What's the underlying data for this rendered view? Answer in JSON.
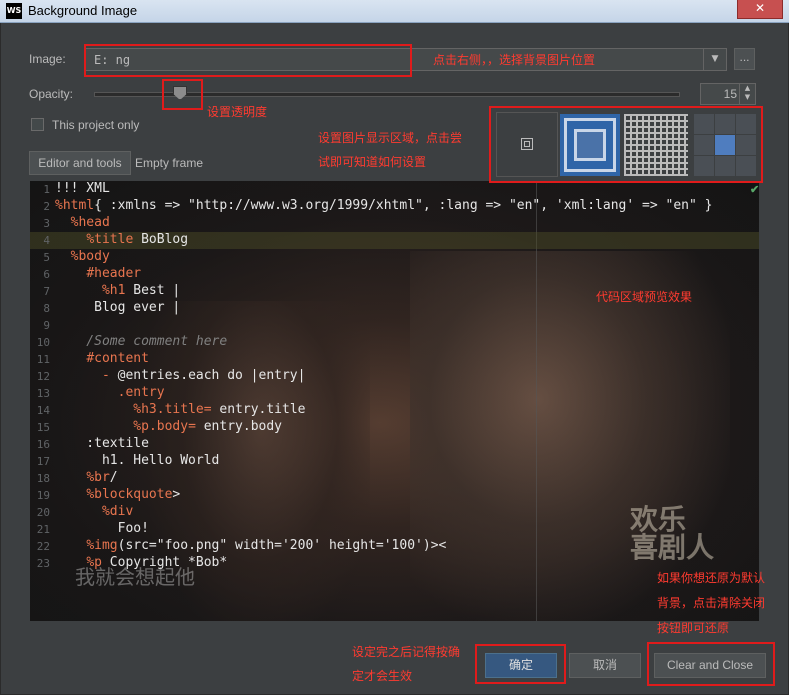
{
  "window": {
    "title": "Background Image",
    "app_icon": "WS",
    "close_label": "✕"
  },
  "image": {
    "label": "Image:",
    "value": "E:                                       ng",
    "browse_label": "..."
  },
  "opacity": {
    "label": "Opacity:",
    "value": "15",
    "fraction": 0.15
  },
  "project_only": {
    "label": "This project only",
    "checked": false
  },
  "tabs": {
    "editor_and_tools": "Editor and tools",
    "empty_frame": "Empty frame"
  },
  "fill_modes": [
    "plain",
    "center-scale",
    "tile",
    "grid-position"
  ],
  "code_lines": [
    {
      "n": "1",
      "t": "!!! XML"
    },
    {
      "n": "2",
      "t": "%html{ :xmlns => \"http://www.w3.org/1999/xhtml\", :lang => \"en\", 'xml:lang' => \"en\" }"
    },
    {
      "n": "3",
      "t": "  %head"
    },
    {
      "n": "4",
      "t": "    %title BoBlog"
    },
    {
      "n": "5",
      "t": "  %body"
    },
    {
      "n": "6",
      "t": "    #header"
    },
    {
      "n": "7",
      "t": "      %h1 Best |"
    },
    {
      "n": "8",
      "t": "     Blog ever |"
    },
    {
      "n": "9",
      "t": ""
    },
    {
      "n": "10",
      "t": "    /Some comment here"
    },
    {
      "n": "11",
      "t": "    #content"
    },
    {
      "n": "12",
      "t": "      - @entries.each do |entry|"
    },
    {
      "n": "13",
      "t": "        .entry"
    },
    {
      "n": "14",
      "t": "          %h3.title= entry.title"
    },
    {
      "n": "15",
      "t": "          %p.body= entry.body"
    },
    {
      "n": "16",
      "t": "    :textile"
    },
    {
      "n": "17",
      "t": "      h1. Hello World"
    },
    {
      "n": "18",
      "t": "    %br/"
    },
    {
      "n": "19",
      "t": "    %blockquote>"
    },
    {
      "n": "20",
      "t": "      %div"
    },
    {
      "n": "21",
      "t": "        Foo!"
    },
    {
      "n": "22",
      "t": "    %img(src=\"foo.png\" width='200' height='100')><"
    },
    {
      "n": "23",
      "t": "    %p Copyright *Bob*"
    }
  ],
  "preview": {
    "subtitle": "我就会想起他",
    "watermark": "欢乐\n喜剧人"
  },
  "buttons": {
    "ok": "确定",
    "cancel": "取消",
    "clear_and_close": "Clear and Close"
  },
  "annotations": {
    "image_hint": "点击右侧，，选择背景图片位置",
    "opacity_hint": "设置透明度",
    "area_hint_1": "设置图片显示区域，点击尝",
    "area_hint_2": "试即可知道如何设置",
    "preview_hint": "代码区域预览效果",
    "restore_hint_1": "如果你想还原为默认",
    "restore_hint_2": "背景，点击清除关闭",
    "restore_hint_3": "按钮即可还原",
    "ok_hint_1": "设定完之后记得按确",
    "ok_hint_2": "定才会生效"
  },
  "colors": {
    "annotation": "#e01b1b",
    "accent": "#365880",
    "keyword": "#e8754f"
  }
}
